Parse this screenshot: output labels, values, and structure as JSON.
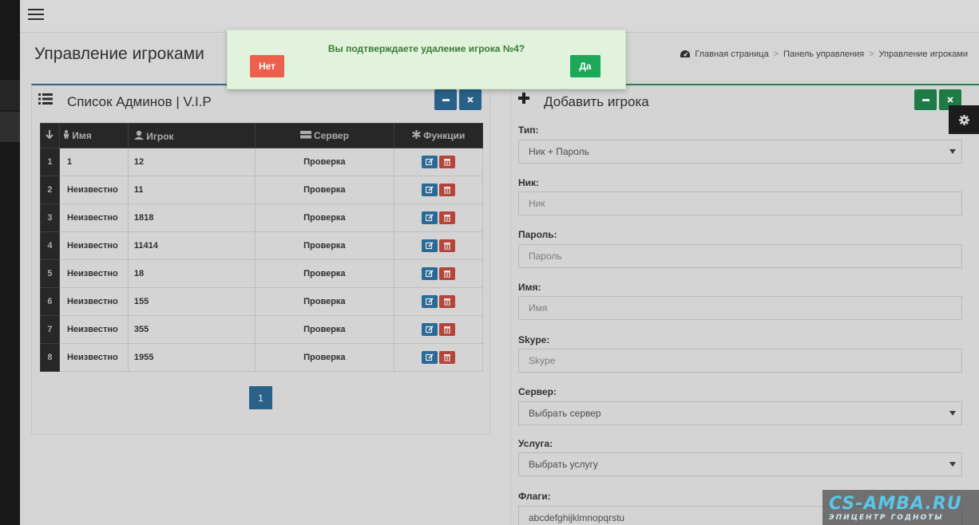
{
  "page": {
    "title": "Управление игроками",
    "breadcrumb": [
      "Главная страница",
      "Панель управления",
      "Управление игроками"
    ]
  },
  "players_panel": {
    "title": "Список Админов | V.I.P",
    "columns": {
      "name": "Имя",
      "player": "Игрок",
      "server": "Сервер",
      "functions": "Функции"
    },
    "rows": [
      {
        "num": "1",
        "name": "1",
        "player": "12",
        "server": "Проверка"
      },
      {
        "num": "2",
        "name": "Неизвестно",
        "player": "11",
        "server": "Проверка"
      },
      {
        "num": "3",
        "name": "Неизвестно",
        "player": "1818",
        "server": "Проверка"
      },
      {
        "num": "4",
        "name": "Неизвестно",
        "player": "11414",
        "server": "Проверка"
      },
      {
        "num": "5",
        "name": "Неизвестно",
        "player": "18",
        "server": "Проверка"
      },
      {
        "num": "6",
        "name": "Неизвестно",
        "player": "155",
        "server": "Проверка"
      },
      {
        "num": "7",
        "name": "Неизвестно",
        "player": "355",
        "server": "Проверка"
      },
      {
        "num": "8",
        "name": "Неизвестно",
        "player": "1955",
        "server": "Проверка"
      }
    ],
    "pagination": {
      "current": "1"
    }
  },
  "add_panel": {
    "title": "Добавить игрока",
    "type": {
      "label": "Тип:",
      "value": "Ник + Пароль"
    },
    "nick": {
      "label": "Ник:",
      "placeholder": "Ник"
    },
    "password": {
      "label": "Пароль:",
      "placeholder": "Пароль"
    },
    "name": {
      "label": "Имя:",
      "placeholder": "Имя"
    },
    "skype": {
      "label": "Skype:",
      "placeholder": "Skype"
    },
    "server": {
      "label": "Сервер:",
      "value": "Выбрать сервер"
    },
    "service": {
      "label": "Услуга:",
      "value": "Выбрать услугу"
    },
    "flags": {
      "label": "Флаги:",
      "value": "abcdefghijklmnopqrstu"
    }
  },
  "dialog": {
    "message": "Вы подтверждаете удаление игрока №4?",
    "no_label": "Нет",
    "yes_label": "Да"
  },
  "watermark": {
    "logo": "CS-AMBA.RU",
    "tagline": "ЭПИЦЕНТР ГОДНОТЫ"
  },
  "colors": {
    "primary": "#2d6a94",
    "success": "#1da759",
    "danger": "#ec5f4d",
    "dialog_bg": "#e1f3dc",
    "dialog_text": "#3b7a3a"
  }
}
